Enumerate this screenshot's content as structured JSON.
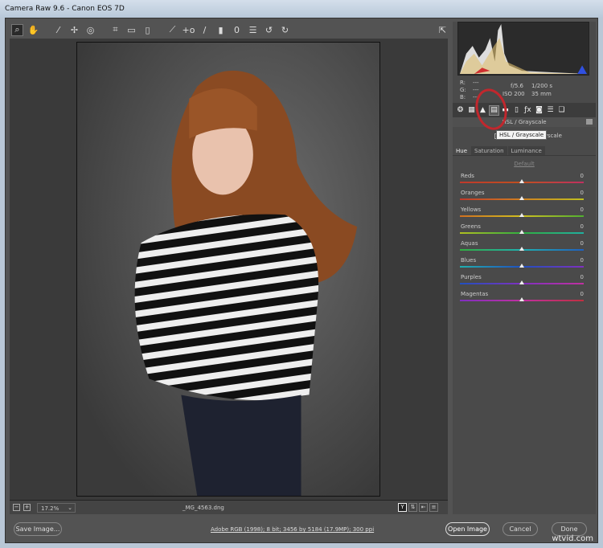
{
  "window": {
    "title": "Camera Raw 9.6  -  Canon EOS 7D"
  },
  "toolbar": {
    "icons": [
      "zoom-tool",
      "hand-tool",
      "white-balance-tool",
      "color-sampler-tool",
      "targeted-adjustment-tool",
      "crop-tool",
      "straighten-tool",
      "transform-tool",
      "spot-removal-tool",
      "red-eye-tool",
      "adjustment-brush",
      "graduated-filter",
      "radial-filter",
      "preferences",
      "rotate-left",
      "rotate-right"
    ],
    "fullscreen": "fullscreen-toggle"
  },
  "status": {
    "zoom": "17.2%",
    "filename": "_MG_4563.dng",
    "view_label": "Y"
  },
  "info": {
    "r_label": "R:",
    "g_label": "G:",
    "b_label": "B:",
    "r": "---",
    "g": "---",
    "b": "---",
    "aperture": "f/5.6",
    "shutter": "1/200 s",
    "iso": "ISO 200",
    "focal": "35 mm"
  },
  "panel": {
    "title": "HSL / Grayscale",
    "tooltip": "HSL / Grayscale",
    "convert": "Convert to Grayscale",
    "tabs": [
      "Hue",
      "Saturation",
      "Luminance"
    ],
    "default_link": "Default",
    "sliders": [
      {
        "label": "Reds",
        "value": "0",
        "colors": "#c0392b,#c05020,#c03060"
      },
      {
        "label": "Oranges",
        "value": "0",
        "colors": "#c0392b,#d08020,#c0c020"
      },
      {
        "label": "Yellows",
        "value": "0",
        "colors": "#d07020,#d0c020,#50b030"
      },
      {
        "label": "Greens",
        "value": "0",
        "colors": "#b0c020,#30b040,#20b0a0"
      },
      {
        "label": "Aquas",
        "value": "0",
        "colors": "#30b040,#20b0b0,#2060c0"
      },
      {
        "label": "Blues",
        "value": "0",
        "colors": "#20b0b0,#2050c0,#8030c0"
      },
      {
        "label": "Purples",
        "value": "0",
        "colors": "#2050c0,#8030c0,#c030a0"
      },
      {
        "label": "Magentas",
        "value": "0",
        "colors": "#8030c0,#c030a0,#c03040"
      }
    ]
  },
  "footer": {
    "save": "Save Image...",
    "workflow": "Adobe RGB (1998); 8 bit; 3456 by 5184 (17.9MP); 300 ppi",
    "open": "Open Image",
    "cancel": "Cancel",
    "done": "Done",
    "watermark": "wtvid.com"
  }
}
